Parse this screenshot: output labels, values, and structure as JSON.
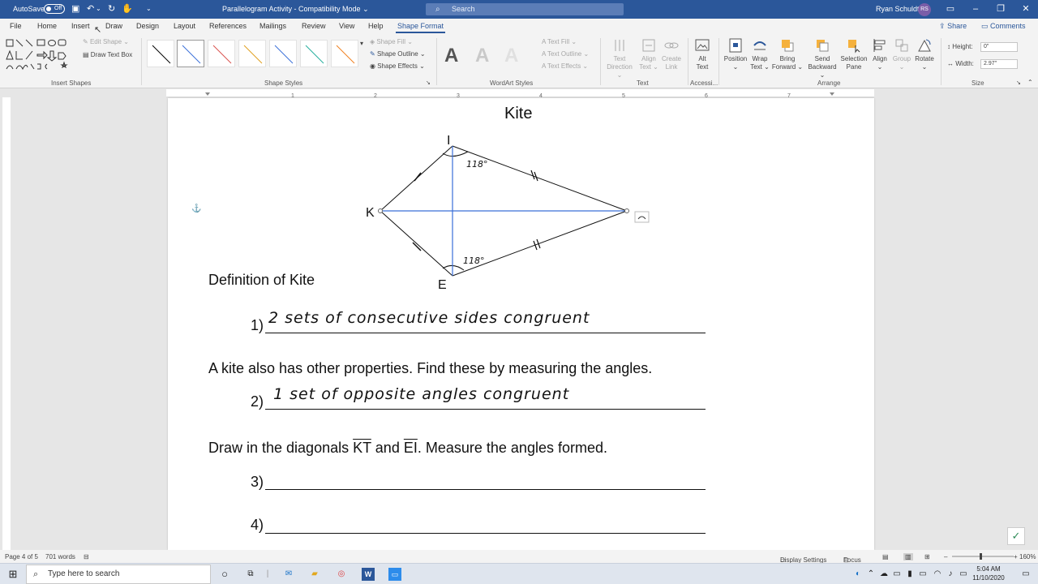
{
  "titlebar": {
    "autosave_label": "AutoSave",
    "autosave_state": "Off",
    "doc_title": "Parallelogram Activity  -  Compatibility Mode",
    "doc_title_arrow": "⌄",
    "search_placeholder": "Search",
    "user_name": "Ryan Schuldt",
    "user_initials": "RS"
  },
  "tabs": {
    "file": "File",
    "home": "Home",
    "insert": "Insert",
    "draw": "Draw",
    "design": "Design",
    "layout": "Layout",
    "references": "References",
    "mailings": "Mailings",
    "review": "Review",
    "view": "View",
    "help": "Help",
    "shape_format": "Shape Format",
    "share": "Share",
    "comments": "Comments"
  },
  "ribbon": {
    "insert_shapes": {
      "label": "Insert Shapes",
      "edit_shape": "Edit Shape",
      "draw_text_box": "Draw Text Box"
    },
    "shape_styles": {
      "label": "Shape Styles",
      "shape_fill": "Shape Fill",
      "shape_outline": "Shape Outline",
      "shape_effects": "Shape Effects"
    },
    "wordart_styles": {
      "label": "WordArt Styles",
      "glyph": "A",
      "text_fill": "Text Fill",
      "text_outline": "Text Outline",
      "text_effects": "Text Effects"
    },
    "text": {
      "label": "Text",
      "text_direction_1": "Text",
      "text_direction_2": "Direction",
      "align_text_1": "Align",
      "align_text_2": "Text",
      "create_link_1": "Create",
      "create_link_2": "Link"
    },
    "accessibility": {
      "label": "Accessi...",
      "alt_text_1": "Alt",
      "alt_text_2": "Text"
    },
    "arrange": {
      "label": "Arrange",
      "position": "Position",
      "wrap_text_1": "Wrap",
      "wrap_text_2": "Text",
      "bring_forward_1": "Bring",
      "bring_forward_2": "Forward",
      "send_backward_1": "Send",
      "send_backward_2": "Backward",
      "selection_pane_1": "Selection",
      "selection_pane_2": "Pane",
      "align": "Align",
      "group": "Group",
      "rotate": "Rotate"
    },
    "size": {
      "label": "Size",
      "height_label": "Height:",
      "height_value": "0\"",
      "width_label": "Width:",
      "width_value": "2.97\""
    }
  },
  "document": {
    "title": "Kite",
    "vertices": {
      "top": "I",
      "left": "K",
      "bottom": "E"
    },
    "angle_top": "118°",
    "angle_bottom": "118°",
    "definition": "Definition of Kite",
    "item1_num": "1)",
    "item1_answer": "2 sets of consecutive sides congruent",
    "properties": "A kite also has other properties.  Find these by measuring the angles.",
    "item2_num": "2)",
    "item2_answer": "1 set of opposite angles congruent",
    "diag_prefix": "Draw in the diagonals ",
    "diag_kt": "KT",
    "diag_and": " and ",
    "diag_ei": "EI",
    "diag_suffix": ".  Measure the angles formed.",
    "item3_num": "3)",
    "item4_num": "4)"
  },
  "statusbar": {
    "page": "Page 4 of 5",
    "words": "701 words",
    "display_settings": "Display Settings",
    "focus": "Focus",
    "zoom": "160%"
  },
  "taskbar": {
    "search_placeholder": "Type here to search",
    "time": "5:04 AM",
    "date": "11/10/2020"
  },
  "colors": {
    "brand": "#2b579a",
    "diagonal": "#3a6fd8"
  }
}
